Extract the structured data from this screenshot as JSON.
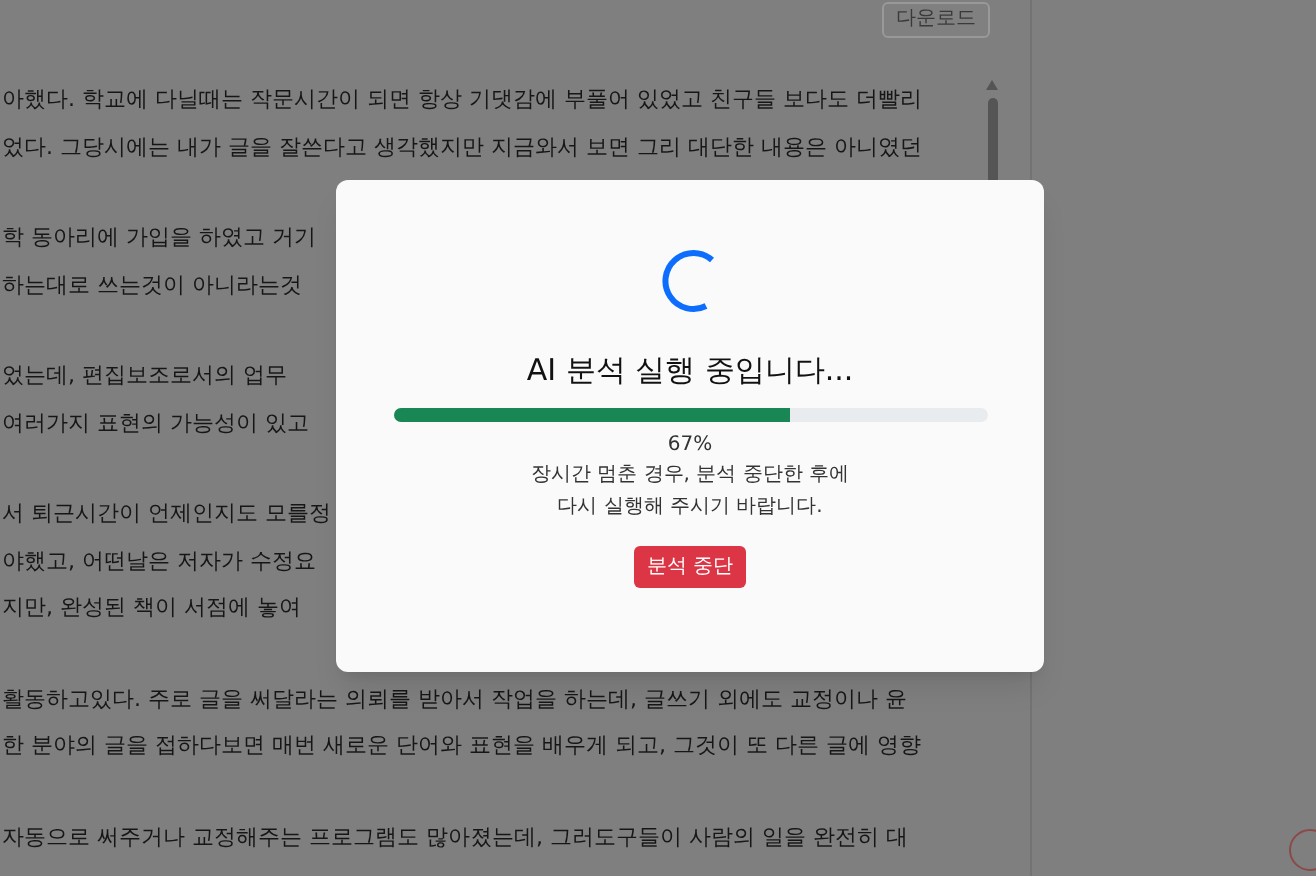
{
  "toolbar": {
    "download_button": "다운로드"
  },
  "document": {
    "paragraphs": [
      [
        "아했다. 학교에 다닐때는 작문시간이 되면 항상 기댓감에 부풀어 있었고 친구들 보다도 더빨리",
        "었다. 그당시에는 내가 글을 잘쓴다고 생각했지만 지금와서 보면 그리 대단한 내용은 아니였던"
      ],
      [
        "학 동아리에 가입을 하였고 거기",
        "하는대로 쓰는것이 아니라는것"
      ],
      [
        "었는데, 편집보조로서의 업무",
        "여러가지 표현의 가능성이 있고"
      ],
      [
        "서 퇴근시간이 언제인지도 모를정",
        "야했고, 어떤날은 저자가 수정요",
        "지만, 완성된 책이 서점에 놓여"
      ],
      [
        "활동하고있다. 주로 글을 써달라는 의뢰를 받아서 작업을 하는데, 글쓰기 외에도 교정이나 윤",
        "한 분야의 글을 접하다보면 매번 새로운 단어와 표현을 배우게 되고, 그것이 또 다른 글에 영향"
      ],
      [
        "자동으로 써주거나 교정해주는 프로그램도 많아졌는데, 그러도구들이 사람의 일을 완전히 대"
      ]
    ]
  },
  "dialog": {
    "title": "AI 분석 실행 중입니다...",
    "progress": {
      "level": 0.67,
      "reading": "67%"
    },
    "message": [
      "장시간 멈춘 경우, 분석 중단한 후에",
      "다시 실행해 주시기 바랍니다."
    ],
    "stop_button": "분석 중단"
  }
}
